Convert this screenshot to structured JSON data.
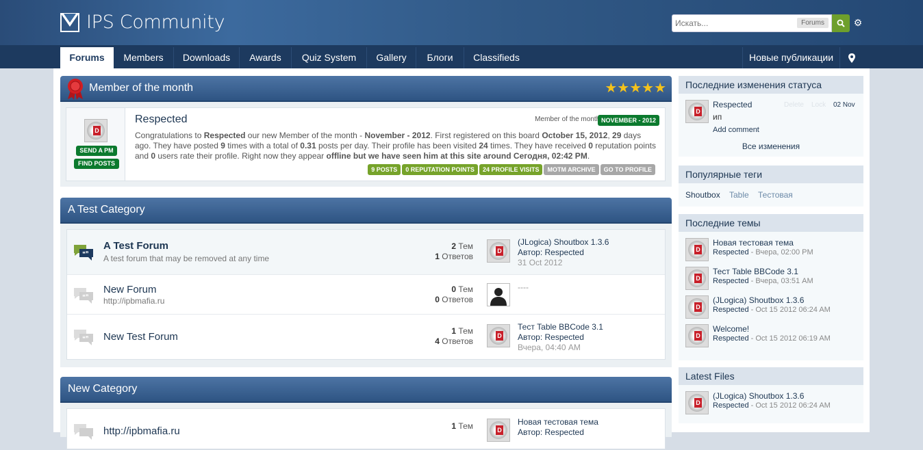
{
  "header": {
    "logo_text": "IPS Community",
    "search_placeholder": "Искать...",
    "search_scope": "Forums"
  },
  "nav": {
    "tabs": [
      "Forums",
      "Members",
      "Downloads",
      "Awards",
      "Quiz System",
      "Gallery",
      "Блоги",
      "Classifieds"
    ],
    "right_link": "Новые публикации"
  },
  "motm": {
    "heading": "Member of the month",
    "stars": 5,
    "name": "Respected",
    "label": "Member of the month:",
    "badge": "NOVEMBER - 2012",
    "send_pm": "SEND A PM",
    "find_posts": "FIND POSTS",
    "text_html": "Congratulations to <b>Respected</b> our new Member of the month - <b>November - 2012</b>. First registered on this board <b>October 15, 2012</b>, <b>29</b> days ago. They have posted <b>9</b> times with a total of <b>0.31</b> posts per day. Their profile has been visited <b>24</b> times. They have received <b>0</b> reputation points and <b>0</b> users rate their profile. Right now they appear <b>offline but we have seen him at this site around Сегодня, 02:42 PM</b>.",
    "tags": [
      {
        "label": "9 POSTS",
        "style": "g"
      },
      {
        "label": "0 REPUTATION POINTS",
        "style": "g"
      },
      {
        "label": "24 PROFILE VISITS",
        "style": "g"
      },
      {
        "label": "MOTM ARCHIVE",
        "style": "gr"
      },
      {
        "label": "GO TO PROFILE",
        "style": "gr"
      }
    ]
  },
  "categories": [
    {
      "title": "A Test Category",
      "forums": [
        {
          "title": "A Test Forum",
          "desc": "A test forum that may be removed at any time",
          "topics": "2",
          "topics_label": "Тем",
          "replies": "1",
          "replies_label": "Ответов",
          "last_title": "(JLogica) Shoutbox 1.3.6",
          "last_by_label": "Автор:",
          "last_by": "Respected",
          "last_date": "31 Oct 2012",
          "unread": true
        },
        {
          "title": "New Forum",
          "desc": "http://ipbmafia.ru",
          "topics": "0",
          "topics_label": "Тем",
          "replies": "0",
          "replies_label": "Ответов",
          "last_title": "----",
          "last_by_label": "",
          "last_by": "",
          "last_date": "",
          "unread": false
        },
        {
          "title": "New Test Forum",
          "desc": "",
          "topics": "1",
          "topics_label": "Тем",
          "replies": "4",
          "replies_label": "Ответов",
          "last_title": "Тест Table BBCode 3.1",
          "last_by_label": "Автор:",
          "last_by": "Respected",
          "last_date": "Вчера, 04:40 AM",
          "unread": false
        }
      ]
    },
    {
      "title": "New Category",
      "forums": [
        {
          "title": "http://ipbmafia.ru",
          "desc": "",
          "topics": "1",
          "topics_label": "Тем",
          "replies": "",
          "replies_label": "",
          "last_title": "Новая тестовая тема",
          "last_by_label": "Автор:",
          "last_by": "Respected",
          "last_date": "",
          "unread": false
        }
      ]
    }
  ],
  "sidebar": {
    "status": {
      "title": "Последние изменения статуса",
      "name": "Respected",
      "text": "ип",
      "delete": "Delete",
      "lock": "Lock",
      "date": "02 Nov",
      "add_comment": "Add comment",
      "all_changes": "Все изменения"
    },
    "tags": {
      "title": "Популярные теги",
      "items": [
        "Shoutbox",
        "Table",
        "Тестовая"
      ]
    },
    "topics": {
      "title": "Последние темы",
      "items": [
        {
          "title": "Новая тестовая тема",
          "author": "Respected",
          "date": "Вчера, 02:00 PM"
        },
        {
          "title": "Тест Table BBCode 3.1",
          "author": "Respected",
          "date": "Вчера, 03:51 AM"
        },
        {
          "title": "(JLogica) Shoutbox 1.3.6",
          "author": "Respected",
          "date": "Oct 15 2012 06:24 AM"
        },
        {
          "title": "Welcome!",
          "author": "Respected",
          "date": "Oct 15 2012 06:19 AM"
        }
      ]
    },
    "files": {
      "title": "Latest Files",
      "items": [
        {
          "title": "(JLogica) Shoutbox 1.3.6",
          "author": "Respected",
          "date": "Oct 15 2012 06:24 AM"
        }
      ]
    }
  }
}
